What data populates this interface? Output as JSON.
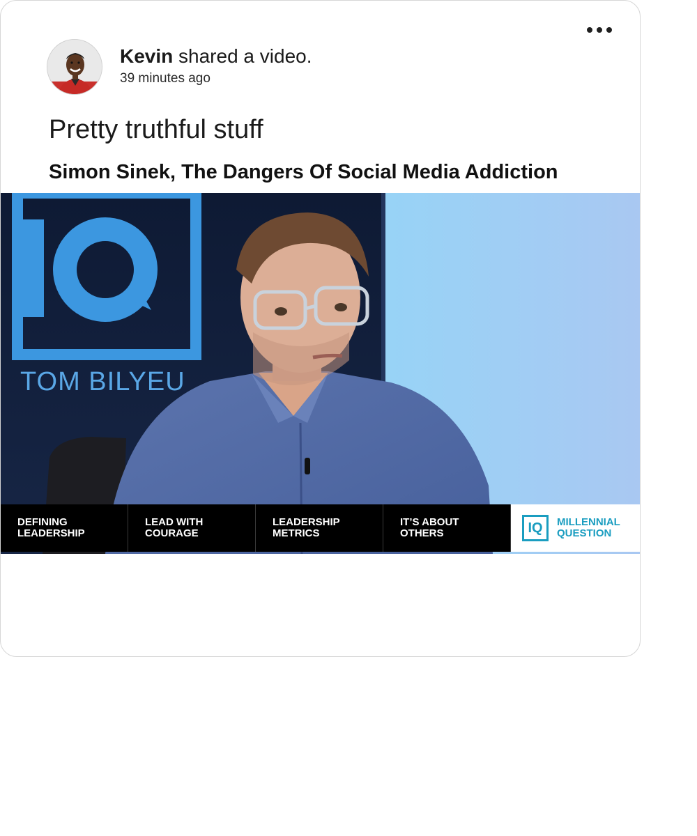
{
  "post": {
    "author_name": "Kevin",
    "action_text": " shared a video.",
    "timestamp": "39 minutes ago",
    "text": "Pretty truthful stuff",
    "more_icon": "more-horizontal-icon"
  },
  "video": {
    "title": "Simon Sinek, The Dangers Of Social Media Addiction",
    "background_wordmark": "TOM BILYEU",
    "background_logo": "IQ",
    "chapters": [
      {
        "line1": "DEFINING",
        "line2": "LEADERSHIP"
      },
      {
        "line1": "LEAD WITH",
        "line2": "COURAGE"
      },
      {
        "line1": "LEADERSHIP",
        "line2": "METRICS"
      },
      {
        "line1": "IT’S ABOUT",
        "line2": "OTHERS"
      }
    ],
    "brand": {
      "logo": "IQ",
      "line1": "MILLENNIAL",
      "line2": "QUESTION",
      "color": "#1a9dc0"
    }
  },
  "colors": {
    "card_border": "#d6d6d6",
    "text": "#1a1a1a",
    "sky_blue": "#8fd3f6",
    "navy": "#0d1a33"
  }
}
